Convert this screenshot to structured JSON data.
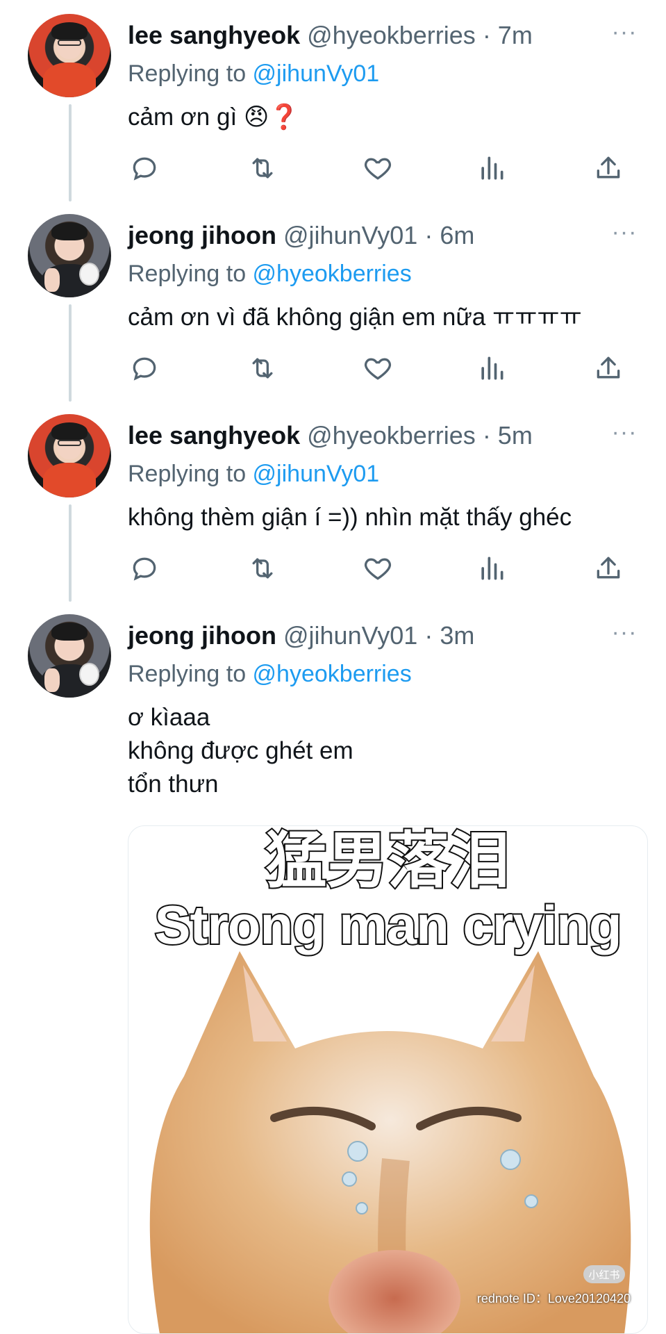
{
  "tweets": [
    {
      "name": "lee sanghyeok",
      "handle": "@hyeokberries",
      "time": "· 7m",
      "replying_prefix": "Replying to ",
      "replying_to": "@jihunVy01",
      "text": "cảm ơn gì 😠❓"
    },
    {
      "name": "jeong jihoon",
      "handle": "@jihunVy01",
      "time": "· 6m",
      "replying_prefix": "Replying to ",
      "replying_to": "@hyeokberries",
      "text": "cảm ơn vì đã không giận em nữa ㅠㅠㅠㅠ"
    },
    {
      "name": "lee sanghyeok",
      "handle": "@hyeokberries",
      "time": "· 5m",
      "replying_prefix": "Replying to ",
      "replying_to": "@jihunVy01",
      "text": "không thèm giận í =)) nhìn mặt thấy ghéc"
    },
    {
      "name": "jeong jihoon",
      "handle": "@jihunVy01",
      "time": "· 3m",
      "replying_prefix": "Replying to ",
      "replying_to": "@hyeokberries",
      "text": "ơ kìaaa\nkhông được ghét em\ntổn thưn"
    }
  ],
  "media": {
    "caption_zh": "猛男落泪",
    "caption_en": "Strong man crying",
    "badge": "小红书",
    "watermark": "rednote ID：Love20120420"
  },
  "more_label": "···",
  "icons": [
    "reply-icon",
    "retweet-icon",
    "like-icon",
    "views-icon",
    "share-icon",
    "more-icon"
  ],
  "colors": {
    "text": "#0f1419",
    "secondary": "#536471",
    "link": "#1d9bf0",
    "thread_line": "#cfd9de"
  }
}
